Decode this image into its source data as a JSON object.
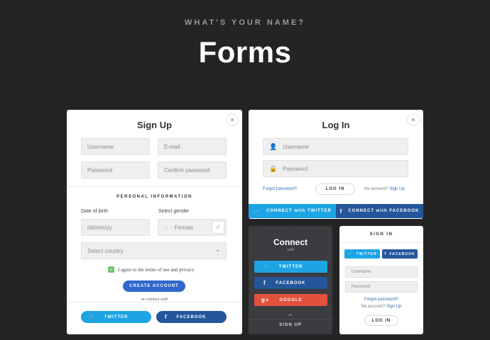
{
  "header": {
    "kicker": "WHAT'S YOUR NAME?",
    "title": "Forms"
  },
  "colors": {
    "twitter": "#1ca4e4",
    "facebook": "#24569a",
    "google": "#e2513c",
    "create_account": "#2e68cc",
    "checkbox": "#6cc26c",
    "dark_card": "#3a3c40"
  },
  "signup": {
    "title": "Sign Up",
    "close": "×",
    "username_placeholder": "Username",
    "email_placeholder": "E-mail",
    "password_placeholder": "Password",
    "confirm_password_placeholder": "Confirm password",
    "section_label": "PERSONAL INFORMATION",
    "dob_label": "Date of birth",
    "dob_placeholder": "dd/mm/yy",
    "gender_label": "Select gender",
    "gender_value": "Female",
    "country_placeholder": "Select country",
    "terms_text": "I agree to the terms of use and privacy",
    "terms_checked": true,
    "create_button": "CREATE ACCOUNT",
    "connect_with": "or connect with",
    "twitter": "TWITTER",
    "facebook": "FACEBOOK"
  },
  "login": {
    "title": "Log In",
    "close": "×",
    "username_placeholder": "Username",
    "password_placeholder": "Password",
    "forgot": "Forgot password?",
    "login_button": "LOG IN",
    "no_account": "No account?",
    "signup_link": "Sign Up",
    "twitter": "CONNECT with TWITTER",
    "facebook": "CONNECT with FACEBOOK"
  },
  "connect": {
    "title": "Connect",
    "with": "with",
    "twitter": "TWITTER",
    "facebook": "FACEBOOK",
    "google": "GOOGLE",
    "or": "or",
    "signup": "SIGN UP"
  },
  "signin": {
    "title": "SIGN IN",
    "twitter": "TWITTER",
    "facebook": "FACEBOOK",
    "username_placeholder": "Username",
    "password_placeholder": "Password",
    "forgot": "Forgot password?",
    "no_account": "No account?",
    "signup_link": "Sign Up",
    "login_button": "LOG IN"
  }
}
